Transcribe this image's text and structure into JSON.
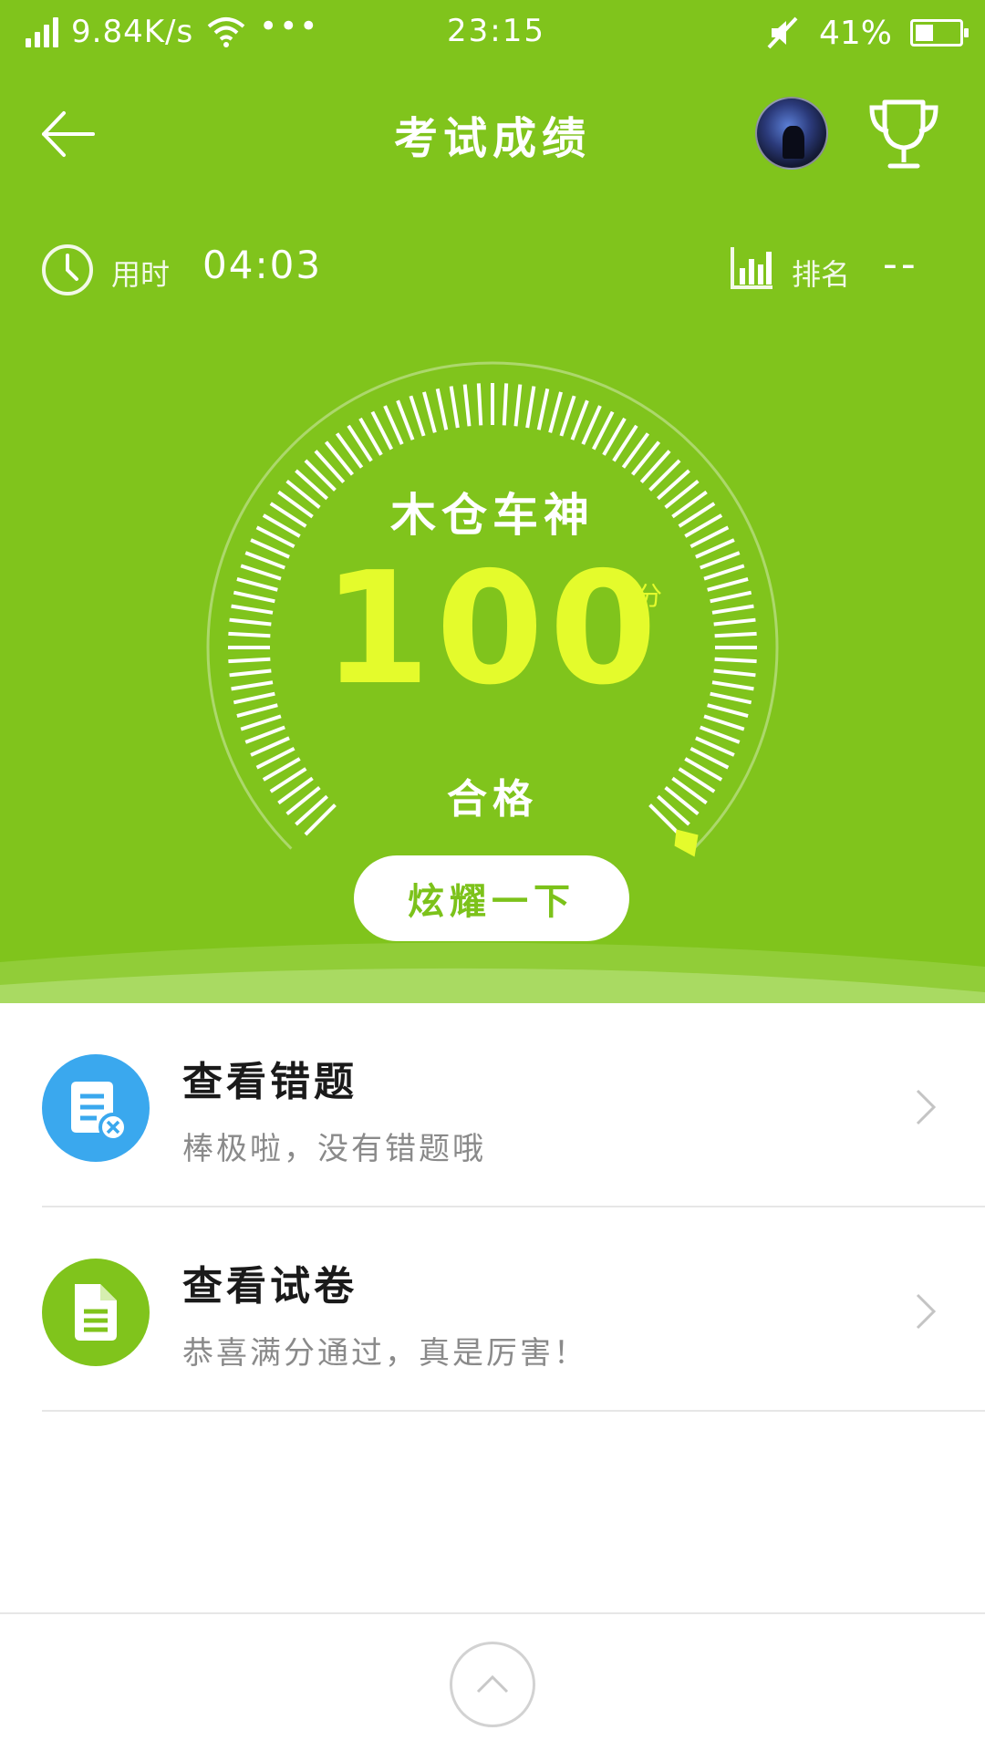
{
  "status_bar": {
    "network_speed": "9.84K/s",
    "more": "•••",
    "time": "23:15",
    "battery_percent": "41%",
    "battery_level": 0.41
  },
  "nav": {
    "title": "考试成绩",
    "back_icon": "arrow-left-icon",
    "trophy_icon": "trophy-icon"
  },
  "stats": {
    "time_label": "用时",
    "time_value": "04:03",
    "rank_label": "排名",
    "rank_value": "--"
  },
  "gauge": {
    "title": "木仓车神",
    "score": "100",
    "score_unit": "分",
    "result": "合格",
    "progress": 1.0
  },
  "share_button": "炫耀一下",
  "list": [
    {
      "title": "查看错题",
      "subtitle": "棒极啦，没有错题哦",
      "icon": "wrong-questions-icon",
      "color": "#3aa8ee"
    },
    {
      "title": "查看试卷",
      "subtitle": "恭喜满分通过，真是厉害！",
      "icon": "exam-paper-icon",
      "color": "#80c41c"
    }
  ],
  "colors": {
    "primary_green": "#80c41c",
    "score_yellow": "#e4fb2c",
    "blue": "#3aa8ee"
  }
}
